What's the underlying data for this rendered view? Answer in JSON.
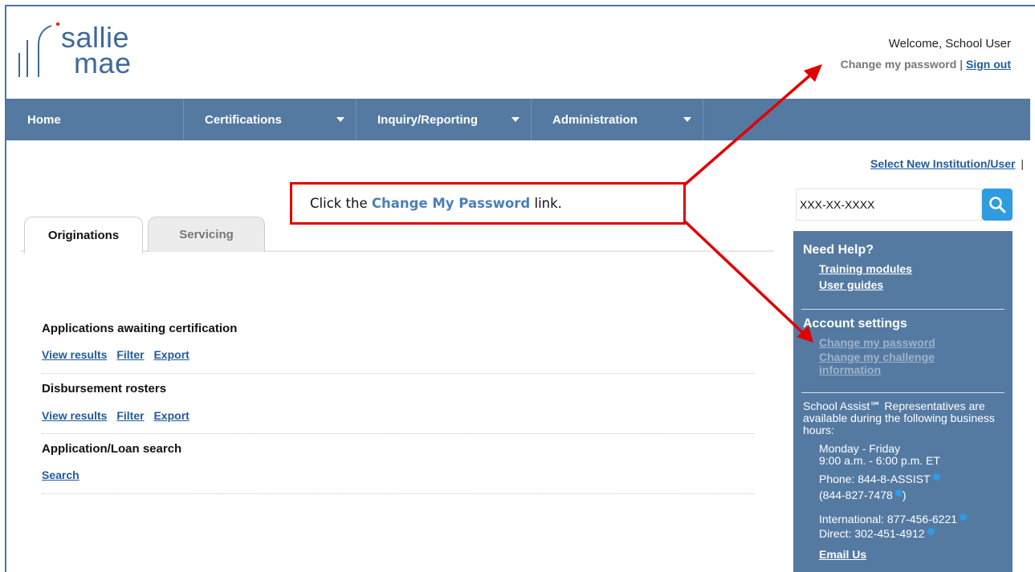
{
  "logo": {
    "line1": "sallie",
    "line2": "mae"
  },
  "header": {
    "welcome": "Welcome, School User",
    "change_password": "Change my password",
    "separator": "|",
    "sign_out": "Sign out"
  },
  "nav": {
    "items": [
      {
        "label": "Home"
      },
      {
        "label": "Certifications"
      },
      {
        "label": "Inquiry/Reporting"
      },
      {
        "label": "Administration"
      }
    ]
  },
  "select_institution": {
    "label": "Select New Institution/User",
    "separator": "|"
  },
  "search": {
    "value": "XXX-XX-XXXX",
    "icon": "search-icon",
    "button_color": "#2f9ce0"
  },
  "tabs": [
    {
      "label": "Originations"
    },
    {
      "label": "Servicing"
    }
  ],
  "sections": [
    {
      "title": "Applications awaiting certification",
      "links": [
        "View results",
        "Filter",
        "Export"
      ]
    },
    {
      "title": "Disbursement rosters",
      "links": [
        "View results",
        "Filter",
        "Export"
      ]
    },
    {
      "title": "Application/Loan search",
      "links": [
        "Search"
      ]
    }
  ],
  "panel": {
    "help_title": "Need Help?",
    "help_links": [
      "Training modules",
      "User guides"
    ],
    "account_title": "Account settings",
    "account_links": [
      "Change my password",
      "Change my challenge information"
    ],
    "hours_intro": "School Assist℠ Representatives are available during the following business hours:",
    "days": "Monday - Friday",
    "hours": "9:00 a.m. - 6:00 p.m. ET",
    "phone": "Phone: 844-8-ASSIST",
    "phone_numeric": "(844-827-7478",
    "phone_numeric_close": ")",
    "international": "International: 877-456-6221",
    "direct": "Direct: 302-451-4912",
    "email": "Email Us"
  },
  "callout": {
    "prefix": "Click the",
    "highlight": "Change My Password",
    "suffix": "link."
  },
  "colors": {
    "nav_bg": "#547aa2",
    "link": "#1f5a9a",
    "callout_border": "#e00000",
    "arrow": "#e00000"
  }
}
